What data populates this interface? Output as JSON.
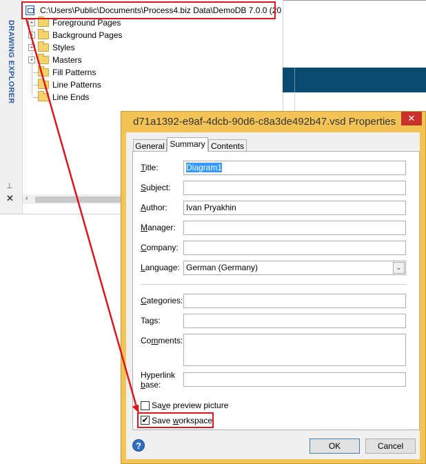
{
  "explorer": {
    "title": "DRAWING EXPLORER",
    "root_path": "C:\\Users\\Public\\Documents\\Process4.biz Data\\DemoDB 7.0.0 (20",
    "items": [
      {
        "label": "Foreground Pages",
        "expandable": true
      },
      {
        "label": "Background Pages",
        "expandable": true
      },
      {
        "label": "Styles",
        "expandable": true
      },
      {
        "label": "Masters",
        "expandable": true
      },
      {
        "label": "Fill Patterns",
        "expandable": false
      },
      {
        "label": "Line Patterns",
        "expandable": false
      },
      {
        "label": "Line Ends",
        "expandable": false
      }
    ],
    "pin_glyph": "⊥",
    "close_glyph": "✕",
    "scroll_left_glyph": "‹"
  },
  "dialog": {
    "title": "d71a1392-e9af-4dcb-90d6-c8a3de492b47.vsd Properties",
    "close_glyph": "✕",
    "tabs": [
      {
        "label": "General",
        "active": false
      },
      {
        "label": "Summary",
        "active": true
      },
      {
        "label": "Contents",
        "active": false
      }
    ],
    "fields": {
      "title": {
        "label_pre": "",
        "label_u": "T",
        "label_post": "itle:",
        "value": "Diagram1"
      },
      "subject": {
        "label_pre": "",
        "label_u": "S",
        "label_post": "ubject:",
        "value": ""
      },
      "author": {
        "label_pre": "",
        "label_u": "A",
        "label_post": "uthor:",
        "value": "Ivan Pryakhin"
      },
      "manager": {
        "label_pre": "",
        "label_u": "M",
        "label_post": "anager:",
        "value": ""
      },
      "company": {
        "label_pre": "",
        "label_u": "C",
        "label_post": "ompany:",
        "value": ""
      },
      "language": {
        "label_pre": "",
        "label_u": "L",
        "label_post": "anguage:",
        "value": "German (Germany)"
      },
      "categories": {
        "label_pre": "",
        "label_u": "C",
        "label_post": "ategories:",
        "value": ""
      },
      "tags": {
        "label_pre": "Ta",
        "label_u": "g",
        "label_post": "s:",
        "value": ""
      },
      "comments": {
        "label_pre": "Co",
        "label_u": "m",
        "label_post": "ments:",
        "value": ""
      },
      "hyperlink_base": {
        "label_line1": "Hyperlink",
        "label_line2_u": "b",
        "label_line2_post": "ase:",
        "value": ""
      }
    },
    "save_preview": {
      "label_pre": "Sa",
      "label_u": "v",
      "label_post": "e preview picture",
      "checked": false
    },
    "save_workspace": {
      "label_pre": "Save ",
      "label_u": "w",
      "label_post": "orkspace",
      "checked": true
    },
    "check_glyph": "✔",
    "dropdown_glyph": "⌄",
    "help_glyph": "?",
    "ok_label": "OK",
    "cancel_label": "Cancel"
  },
  "colors": {
    "annotation_red": "#e0141a",
    "dialog_frame": "#f3c455",
    "canvas_band": "#0a4a70",
    "explorer_title": "#2a5ba8"
  }
}
